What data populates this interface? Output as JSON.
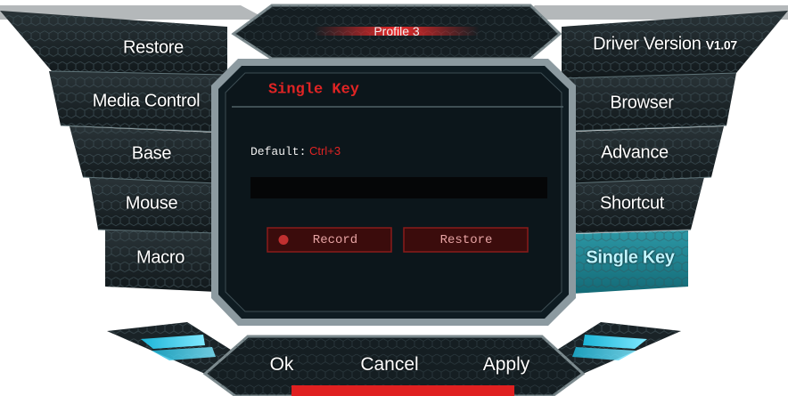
{
  "profile": {
    "label": "Profile 3"
  },
  "left_menu": [
    {
      "label": "Restore"
    },
    {
      "label": "Media Control"
    },
    {
      "label": "Base"
    },
    {
      "label": "Mouse"
    },
    {
      "label": "Macro"
    }
  ],
  "right_menu": [
    {
      "label": "Driver Version",
      "version": "V1.07"
    },
    {
      "label": "Browser"
    },
    {
      "label": "Advance"
    },
    {
      "label": "Shortcut"
    },
    {
      "label": "Single Key",
      "active": true
    }
  ],
  "dialog": {
    "title": "Single Key",
    "default_label": "Default:",
    "default_value": "Ctrl+3",
    "key_input_value": "",
    "record_label": "Record",
    "restore_label": "Restore"
  },
  "footer": {
    "ok": "Ok",
    "cancel": "Cancel",
    "apply": "Apply"
  },
  "colors": {
    "accent_red": "#e02020",
    "active_teal": "#1f7f8c",
    "panel": "#0f1c22"
  }
}
